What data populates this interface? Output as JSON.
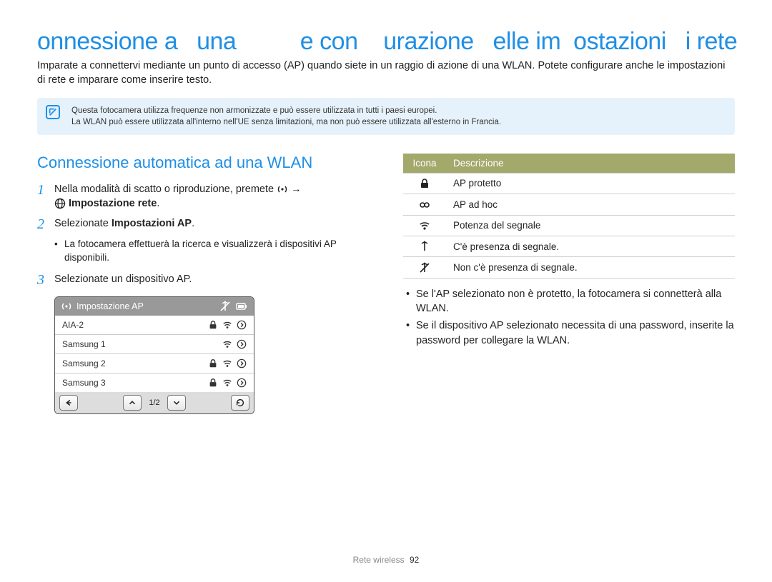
{
  "title": "onnessione a   una          e con    urazione   elle im  ostazioni   i rete",
  "intro": "Imparate a connettervi mediante un punto di accesso (AP) quando siete in un raggio di azione di una WLAN. Potete configurare anche le impostazioni di rete e imparare come inserire testo.",
  "note": {
    "line1": "Questa fotocamera utilizza frequenze non armonizzate e può essere utilizzata in tutti i paesi europei.",
    "line2": "La WLAN può essere utilizzata all'interno nell'UE senza limitazioni, ma non può essere utilizzata all'esterno in Francia."
  },
  "left": {
    "subtitle": "Connessione automatica ad una WLAN",
    "step1_a": "Nella modalità di scatto o riproduzione, premete ",
    "step1_b": " → ",
    "step1_c": "Impostazione rete",
    "step1_d": ".",
    "step2_a": "Selezionate ",
    "step2_b": "Impostazioni AP",
    "step2_c": ".",
    "step2_bullet": "La fotocamera effettuerà la ricerca e visualizzerà i dispositivi AP disponibili.",
    "step3": "Selezionate un dispositivo AP."
  },
  "ap_widget": {
    "title": "Impostazione AP",
    "rows": [
      {
        "name": "AIA-2",
        "lock": true,
        "wifi": true,
        "arrow": true
      },
      {
        "name": "Samsung 1",
        "lock": false,
        "wifi": true,
        "arrow": true
      },
      {
        "name": "Samsung 2",
        "lock": true,
        "wifi": true,
        "arrow": true
      },
      {
        "name": "Samsung 3",
        "lock": true,
        "wifi": true,
        "arrow": true
      }
    ],
    "page_indicator": "1/2"
  },
  "right": {
    "headers": {
      "icon": "Icona",
      "desc": "Descrizione"
    },
    "rows": [
      {
        "icon": "lock",
        "desc": "AP protetto"
      },
      {
        "icon": "adhoc",
        "desc": "AP ad hoc"
      },
      {
        "icon": "wifi",
        "desc": "Potenza del segnale"
      },
      {
        "icon": "antenna",
        "desc": "C'è presenza di segnale."
      },
      {
        "icon": "antenna-off",
        "desc": "Non c'è presenza di segnale."
      }
    ],
    "bullets": [
      "Se l'AP selezionato non è protetto, la fotocamera si connetterà alla WLAN.",
      "Se il dispositivo AP selezionato necessita di una password, inserite la password per collegare la WLAN."
    ]
  },
  "footer": {
    "label": "Rete wireless",
    "page": "92"
  }
}
